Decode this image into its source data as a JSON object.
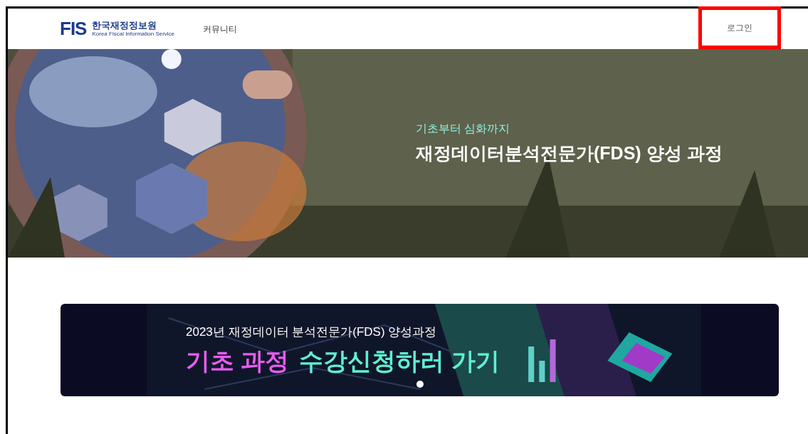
{
  "header": {
    "logo_mark": "FIS",
    "logo_name": "한국재정정보원",
    "logo_subtitle": "Korea Fiscal Information Service",
    "nav": [
      {
        "label": "커뮤니티"
      }
    ],
    "login": {
      "label": "로그인",
      "highlighted": true
    }
  },
  "hero": {
    "kind": "picture",
    "subtitle": "기초부터 심화까지",
    "title": "재정데이터분석전문가(FDS) 양성 과정"
  },
  "banner": {
    "kind": "picture",
    "line1": "2023년 재정데이터 분석전문가(FDS) 양성과정",
    "highlight": "기초 과정",
    "cta": "수강신청하러 가기",
    "dots": [
      {
        "selected": true
      }
    ]
  }
}
